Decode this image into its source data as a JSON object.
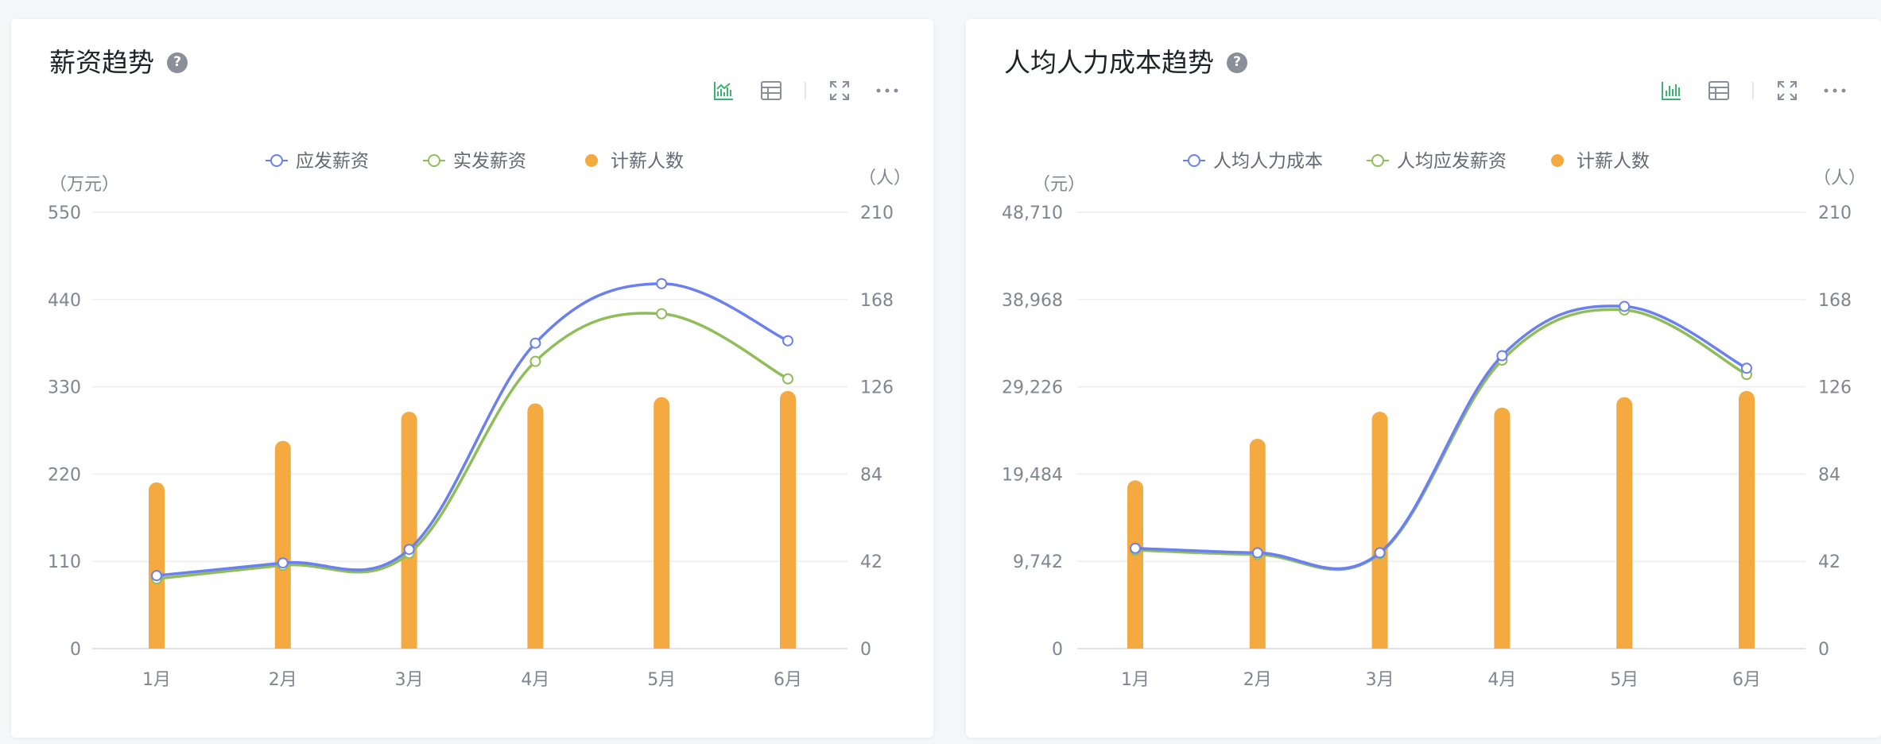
{
  "colors": {
    "blue": "#6a7ff0",
    "green": "#8fbd5a",
    "orange": "#f5a941",
    "axis_text": "#7f8591",
    "grid": "#eef0f3",
    "tool_active": "#3cb371",
    "tool_inactive": "#8a8f99"
  },
  "cards": [
    {
      "title": "薪资趋势",
      "help_icon_text": "?",
      "toolbar": [
        "line-chart-icon",
        "table-icon",
        "fullscreen-icon",
        "more-icon"
      ],
      "active_tool": "line-chart-icon"
    },
    {
      "title": "人均人力成本趋势",
      "help_icon_text": "?",
      "toolbar": [
        "bar-chart-icon",
        "table-icon",
        "fullscreen-icon",
        "more-icon"
      ],
      "active_tool": "bar-chart-icon"
    }
  ],
  "chart_data": [
    {
      "type": "bar-line",
      "categories": [
        "1月",
        "2月",
        "3月",
        "4月",
        "5月",
        "6月"
      ],
      "y_left": {
        "unit": "（万元）",
        "min": 0,
        "max": 550,
        "ticks": [
          "0",
          "110",
          "220",
          "330",
          "440",
          "550"
        ]
      },
      "y_right": {
        "unit": "（人）",
        "min": 0,
        "max": 210,
        "ticks": [
          "0",
          "42",
          "84",
          "126",
          "168",
          "210"
        ]
      },
      "legend": {
        "position": "top-center"
      },
      "grid": true,
      "series": [
        {
          "name": "应发薪资",
          "type": "line",
          "axis": "left",
          "color": "#6a7ff0",
          "values": [
            92,
            108,
            125,
            385,
            460,
            388
          ]
        },
        {
          "name": "实发薪资",
          "type": "line",
          "axis": "left",
          "color": "#8fbd5a",
          "values": [
            88,
            105,
            120,
            362,
            422,
            340
          ]
        },
        {
          "name": "计薪人数",
          "type": "bar",
          "axis": "right",
          "color": "#f5a941",
          "values": [
            80,
            100,
            114,
            118,
            121,
            124
          ]
        }
      ]
    },
    {
      "type": "bar-line",
      "categories": [
        "1月",
        "2月",
        "3月",
        "4月",
        "5月",
        "6月"
      ],
      "y_left": {
        "unit": "（元）",
        "min": 0,
        "max": 48710,
        "ticks": [
          "0",
          "9,742",
          "19,484",
          "29,226",
          "38,968",
          "48,710"
        ]
      },
      "y_right": {
        "unit": "（人）",
        "min": 0,
        "max": 210,
        "ticks": [
          "0",
          "42",
          "84",
          "126",
          "168",
          "210"
        ]
      },
      "legend": {
        "position": "top-center"
      },
      "grid": true,
      "series": [
        {
          "name": "人均人力成本",
          "type": "line",
          "axis": "left",
          "color": "#6a7ff0",
          "values": [
            11200,
            10700,
            10700,
            32700,
            38200,
            31300
          ]
        },
        {
          "name": "人均应发薪资",
          "type": "line",
          "axis": "left",
          "color": "#8fbd5a",
          "values": [
            11000,
            10500,
            10600,
            32200,
            37800,
            30600
          ]
        },
        {
          "name": "计薪人数",
          "type": "bar",
          "axis": "right",
          "color": "#f5a941",
          "values": [
            81,
            101,
            114,
            116,
            121,
            124
          ]
        }
      ]
    }
  ]
}
